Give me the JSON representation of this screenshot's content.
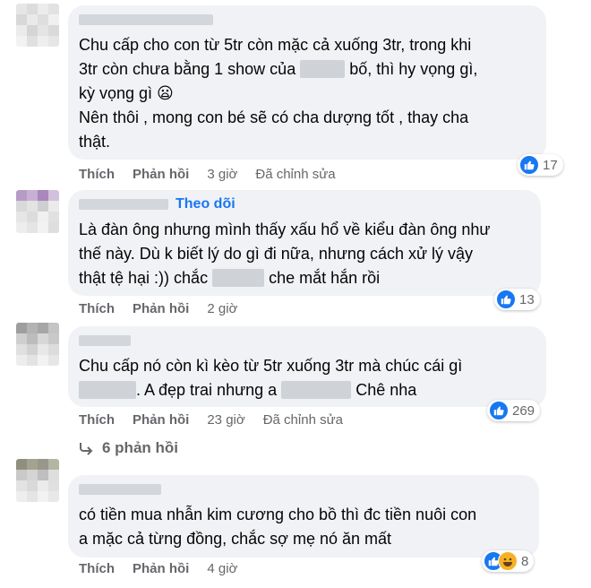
{
  "comments": [
    {
      "lines": [
        "Chu cấp cho con từ 5tr còn mặc cả xuống 3tr, trong khi",
        "3tr còn chưa bằng 1 show của",
        "bố, thì hy vọng gì,",
        "kỳ vọng gì 😦",
        "Nên thôi , mong con bé sẽ có cha dượng tốt , thay cha",
        "thật."
      ],
      "like": "Thích",
      "reply": "Phản hồi",
      "time": "3 giờ",
      "edited": "Đã chỉnh sửa",
      "reaction_count": "17"
    },
    {
      "follow": "Theo dõi",
      "lines": [
        "Là đàn ông nhưng mình thấy xấu hổ về kiểu đàn ông như",
        "thế này. Dù k biết lý do gì đi nữa, nhưng cách xử lý vậy",
        "thật tệ hại :)) chắc",
        "che mắt hắn rồi"
      ],
      "like": "Thích",
      "reply": "Phản hồi",
      "time": "2 giờ",
      "reaction_count": "13"
    },
    {
      "lines": [
        "Chu cấp nó còn kì kèo từ 5tr xuống 3tr mà chúc cái gì",
        ". A đẹp trai nhưng a",
        "Chê nha"
      ],
      "like": "Thích",
      "reply": "Phản hồi",
      "time": "23 giờ",
      "edited": "Đã chỉnh sửa",
      "reaction_count": "269",
      "replies": "6 phản hồi"
    },
    {
      "lines": [
        "có tiền mua nhẫn kim cương cho bồ thì đc tiền nuôi con",
        "a mặc cả từng đồng, chắc sợ mẹ nó ăn mất"
      ],
      "like": "Thích",
      "reply": "Phản hồi",
      "time": "4 giờ",
      "reaction_count": "8"
    }
  ],
  "colors": {
    "like": "#1877f2",
    "haha": "#f7b125",
    "bubble": "#f0f2f5",
    "meta": "#65676b"
  }
}
